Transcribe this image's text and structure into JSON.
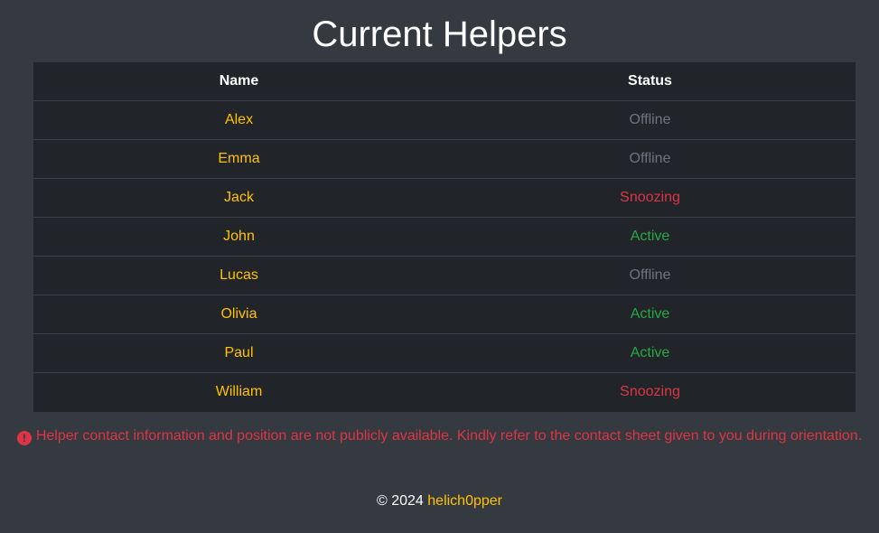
{
  "page_title": "Current Helpers",
  "table": {
    "headers": [
      "Name",
      "Status"
    ],
    "rows": [
      {
        "name": "Alex",
        "status": "Offline",
        "status_kind": "offline"
      },
      {
        "name": "Emma",
        "status": "Offline",
        "status_kind": "offline"
      },
      {
        "name": "Jack",
        "status": "Snoozing",
        "status_kind": "snoozing"
      },
      {
        "name": "John",
        "status": "Active",
        "status_kind": "active"
      },
      {
        "name": "Lucas",
        "status": "Offline",
        "status_kind": "offline"
      },
      {
        "name": "Olivia",
        "status": "Active",
        "status_kind": "active"
      },
      {
        "name": "Paul",
        "status": "Active",
        "status_kind": "active"
      },
      {
        "name": "William",
        "status": "Snoozing",
        "status_kind": "snoozing"
      }
    ]
  },
  "notice": {
    "icon": "exclamation-circle-icon",
    "text": "Helper contact information and position are not publicly available. Kindly refer to the contact sheet given to you during orientation."
  },
  "footer": {
    "copyright": "© 2024",
    "author": "helich0pper"
  },
  "colors": {
    "background": "#343a40",
    "table_bg": "#212529",
    "name": "#ffc107",
    "offline": "#6c757d",
    "snoozing": "#dc3545",
    "active": "#28a745",
    "notice": "#dc3545"
  }
}
